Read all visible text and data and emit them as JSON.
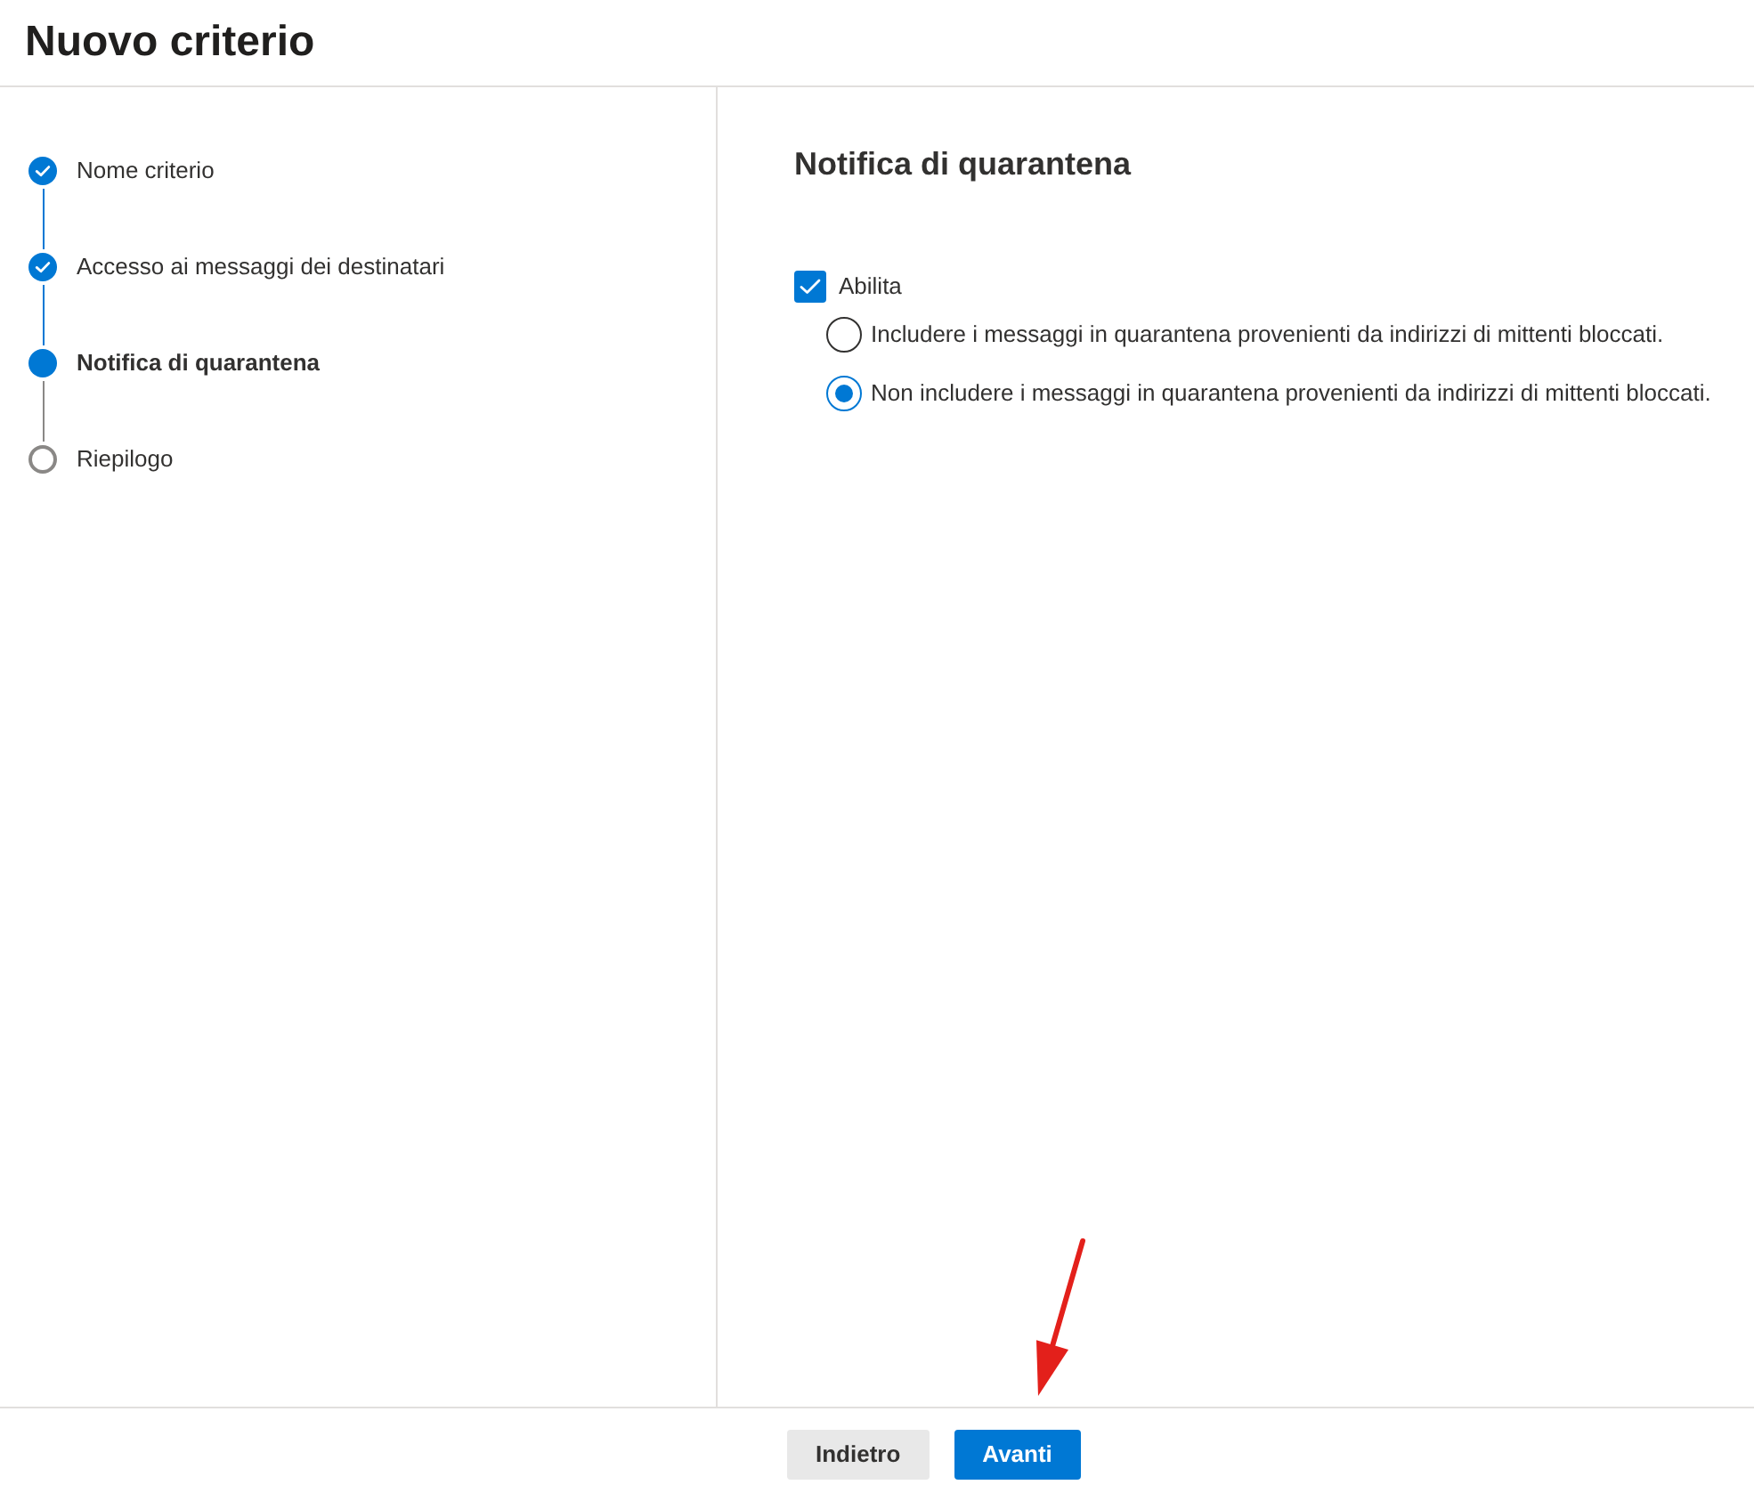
{
  "header": {
    "title": "Nuovo criterio"
  },
  "steps": [
    {
      "label": "Nome criterio",
      "completed": true,
      "selected": false
    },
    {
      "label": "Accesso ai messaggi dei destinatari",
      "completed": true,
      "selected": false
    },
    {
      "label": "Notifica di quarantena",
      "completed": false,
      "selected": true
    },
    {
      "label": "Riepilogo",
      "completed": false,
      "selected": false
    }
  ],
  "panel": {
    "heading": "Notifica di quarantena",
    "enable": {
      "label": "Abilita",
      "checked": true
    },
    "options": [
      {
        "label": "Includere i messaggi in quarantena provenienti da indirizzi di mittenti bloccati.",
        "selected": false
      },
      {
        "label": "Non includere i messaggi in quarantena provenienti da indirizzi di mittenti bloccati.",
        "selected": true
      }
    ]
  },
  "footer": {
    "buttons": [
      {
        "label": "Indietro",
        "kind": "secondary"
      },
      {
        "label": "Avanti",
        "kind": "primary"
      }
    ]
  },
  "annotations": [
    {
      "kind": "arrow"
    }
  ]
}
